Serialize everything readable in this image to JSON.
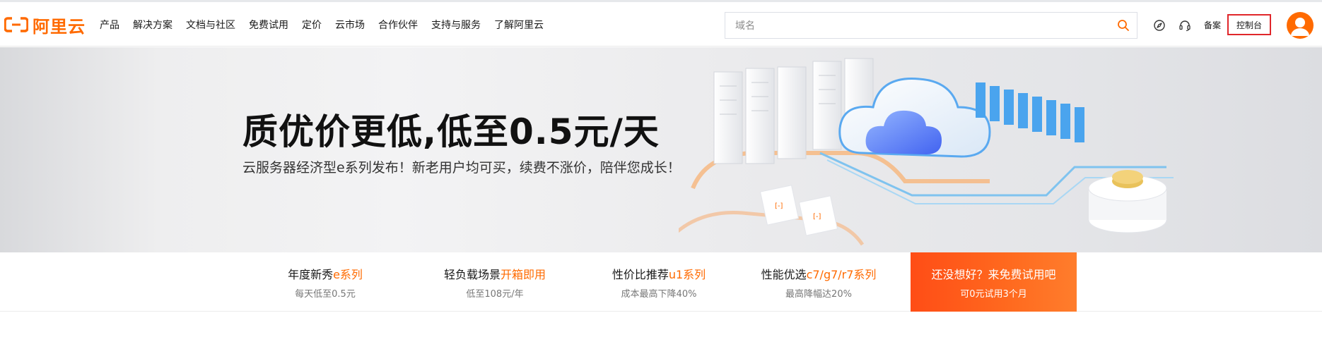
{
  "brand": {
    "name": "阿里云",
    "color": "#ff6a00"
  },
  "nav": [
    {
      "label": "产品"
    },
    {
      "label": "解决方案"
    },
    {
      "label": "文档与社区"
    },
    {
      "label": "免费试用"
    },
    {
      "label": "定价"
    },
    {
      "label": "云市场"
    },
    {
      "label": "合作伙伴"
    },
    {
      "label": "支持与服务"
    },
    {
      "label": "了解阿里云"
    }
  ],
  "search": {
    "placeholder": "域名",
    "icon": "search-icon"
  },
  "header_actions": {
    "icons": [
      "compass-icon",
      "headset-icon"
    ],
    "beian_label": "备案",
    "console_label": "控制台",
    "avatar_icon": "user-avatar-icon"
  },
  "banner": {
    "title": "质优价更低,低至0.5元/天",
    "subtitle": "云服务器经济型e系列发布！新老用户均可买，续费不涨价，陪伴您成长！"
  },
  "tabs": [
    {
      "title_prefix": "年度新秀",
      "title_highlight": "e系列",
      "sub": "每天低至0.5元"
    },
    {
      "title_prefix": "轻负载场景",
      "title_highlight": "开箱即用",
      "sub": "低至108元/年"
    },
    {
      "title_prefix": "性价比推荐",
      "title_highlight": "u1系列",
      "sub": "成本最高下降40%"
    },
    {
      "title_prefix": "性能优选",
      "title_highlight": "c7/g7/r7系列",
      "sub": "最高降幅达20%"
    }
  ],
  "cta": {
    "title": "还没想好？来免费试用吧",
    "sub": "可0元试用3个月",
    "color": "#ff5a1a"
  }
}
